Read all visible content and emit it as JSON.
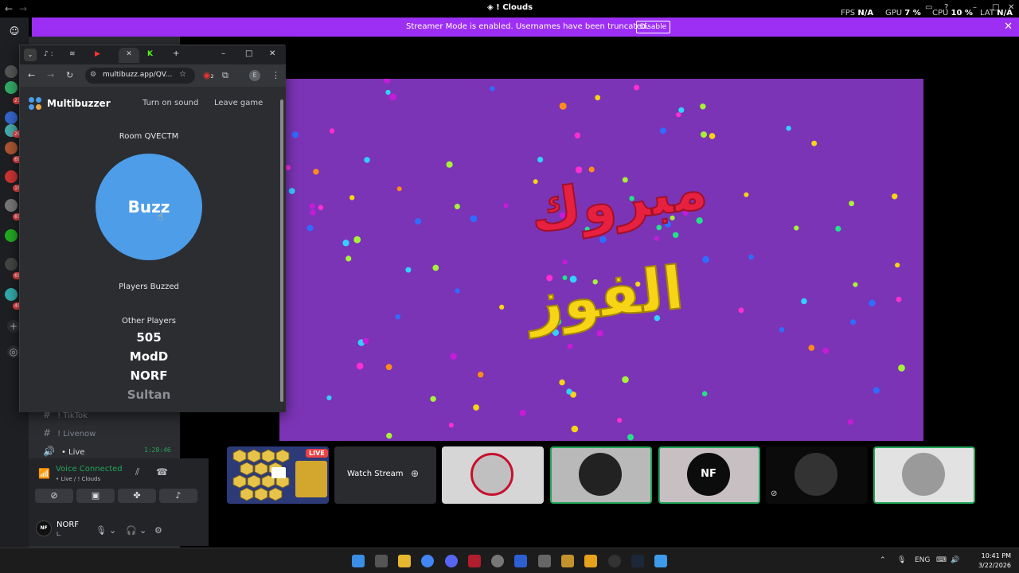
{
  "titlebar": {
    "title": "! Clouds",
    "fps_label": "FPS",
    "fps_value": "N/A",
    "gpu_label": "GPU",
    "gpu_value": "7 %",
    "cpu_label": "CPU",
    "cpu_value": "10 %",
    "lat_label": "LAT",
    "lat_value": "N/A"
  },
  "banner": {
    "message": "Streamer Mode is enabled. Usernames have been truncated.",
    "disable_label": "Disable"
  },
  "rail": {
    "badges": [
      "21",
      "29",
      "69",
      "18",
      "81",
      "69",
      "49"
    ]
  },
  "channels": {
    "items": [
      {
        "label": "! TikTok"
      },
      {
        "label": "! Livenow"
      }
    ],
    "live_label": "• Live",
    "live_time": "1:28:46"
  },
  "voice": {
    "title": "Voice Connected",
    "subtitle": "• Live / ! Clouds"
  },
  "user": {
    "name": "NORF",
    "status": "L.",
    "avatar_text": "NF"
  },
  "browser": {
    "url": "multibuzz.app/QV...",
    "extension_badge": "2",
    "profile_letter": "E"
  },
  "multibuzzer": {
    "brand": "Multibuzzer",
    "sound_link": "Turn on sound",
    "leave_link": "Leave game",
    "room_label": "Room QVECTM",
    "buzz_label": "Buzz",
    "players_buzzed_label": "Players Buzzed",
    "other_players_label": "Other Players",
    "players": [
      "505",
      "ModD",
      "NORF",
      "Sultan"
    ]
  },
  "stream": {
    "line1": "مبروك",
    "line2": "الفوز"
  },
  "tiles": {
    "live_badge": "LIVE",
    "watch_label": "Watch Stream",
    "avatar_text": "NF"
  },
  "taskbar": {
    "lang": "ENG",
    "time": "10:41 PM",
    "date": "3/22/2026"
  },
  "colors": {
    "banner": "#9d2ff5",
    "buzz_button": "#4d9de9",
    "stream_bg": "#7b34b5",
    "speaking_border": "#23a55a"
  }
}
